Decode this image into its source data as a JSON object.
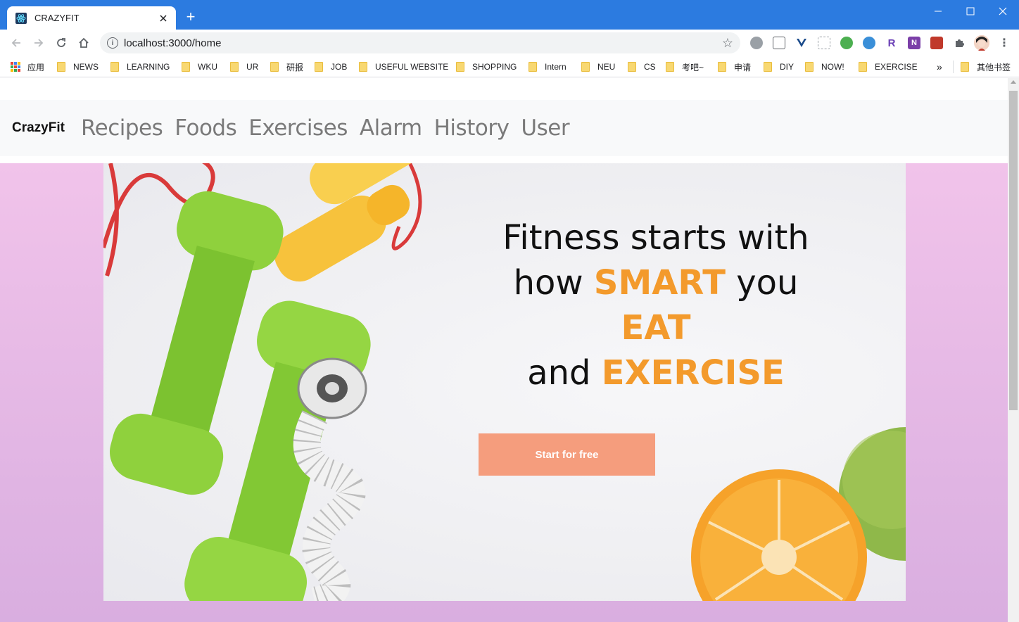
{
  "browser": {
    "tab_title": "CRAZYFIT",
    "new_tab_symbol": "+",
    "url": "localhost:3000/home",
    "bookmarks": [
      "应用",
      "NEWS",
      "LEARNING",
      "WKU",
      "UR",
      "研报",
      "JOB",
      "USEFUL WEBSITE",
      "SHOPPING",
      "Intern",
      "NEU",
      "CS",
      "考吧~",
      "申请",
      "DIY",
      "NOW!",
      "EXERCISE"
    ],
    "bookmarks_overflow": "»",
    "other_bookmarks": "其他书签",
    "extensions": [
      "R",
      "N"
    ],
    "colors": {
      "titlebar": "#2c7be0",
      "accent": "#f39a2c",
      "cta": "#f59d7d"
    }
  },
  "site": {
    "brand": "CrazyFit",
    "nav": [
      "Recipes",
      "Foods",
      "Exercises",
      "Alarm",
      "History",
      "User"
    ],
    "hero": {
      "line1": "Fitness starts with",
      "line2_pre": "how",
      "line2_accent": "SMART",
      "line2_post": "you",
      "line3_accent": "EAT",
      "line4_pre": "and",
      "line4_accent": "EXERCISE",
      "cta": "Start for free"
    }
  }
}
